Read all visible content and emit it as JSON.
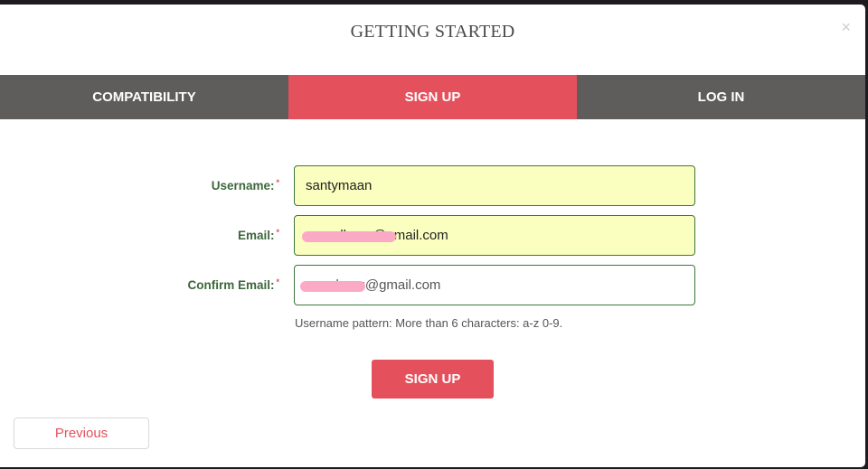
{
  "modal": {
    "title": "GETTING STARTED",
    "close_icon": "×"
  },
  "tabs": [
    {
      "label": "COMPATIBILITY",
      "active": false
    },
    {
      "label": "SIGN UP",
      "active": true
    },
    {
      "label": "LOG IN",
      "active": false
    }
  ],
  "form": {
    "required_marker": "*",
    "fields": [
      {
        "label": "Username:",
        "value": "santymaan"
      },
      {
        "label": "Email:",
        "value": "a·····dhayu@gmail.com"
      },
      {
        "label": "Confirm Email:",
        "value": "a·····hayu@gmail.com"
      }
    ],
    "hint": "Username pattern: More than 6 characters: a-z 0-9.",
    "submit_label": "SIGN UP"
  },
  "footer": {
    "previous_label": "Previous"
  },
  "colors": {
    "accent": "#e5505d",
    "tab_inactive": "#5e5d5b",
    "label_green": "#3c673c",
    "autofill_bg": "#fafebe"
  }
}
